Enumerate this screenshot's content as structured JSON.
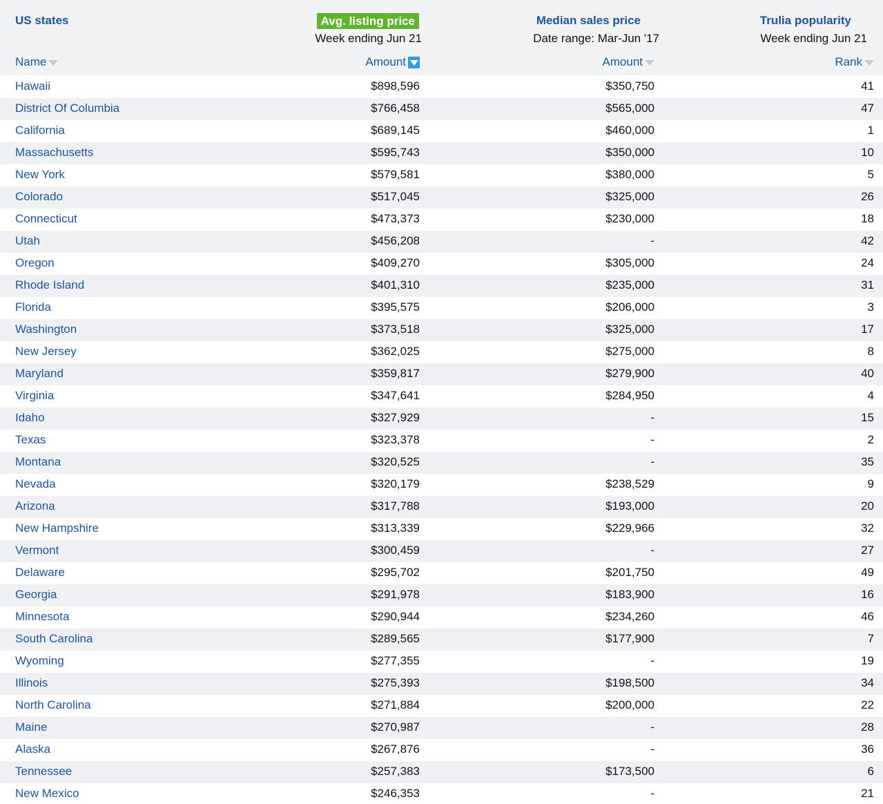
{
  "header": {
    "region_title": "US states",
    "avg_title": "Avg. listing price",
    "avg_sub": "Week ending Jun 21",
    "median_title": "Median sales price",
    "median_sub": "Date range: Mar-Jun '17",
    "popularity_title": "Trulia popularity",
    "popularity_sub": "Week ending Jun 21",
    "col_name": "Name",
    "col_avg": "Amount",
    "col_median": "Amount",
    "col_rank": "Rank"
  },
  "rows": [
    {
      "name": "Hawaii",
      "avg": "$898,596",
      "median": "$350,750",
      "rank": "41"
    },
    {
      "name": "District Of Columbia",
      "avg": "$766,458",
      "median": "$565,000",
      "rank": "47"
    },
    {
      "name": "California",
      "avg": "$689,145",
      "median": "$460,000",
      "rank": "1"
    },
    {
      "name": "Massachusetts",
      "avg": "$595,743",
      "median": "$350,000",
      "rank": "10"
    },
    {
      "name": "New York",
      "avg": "$579,581",
      "median": "$380,000",
      "rank": "5"
    },
    {
      "name": "Colorado",
      "avg": "$517,045",
      "median": "$325,000",
      "rank": "26"
    },
    {
      "name": "Connecticut",
      "avg": "$473,373",
      "median": "$230,000",
      "rank": "18"
    },
    {
      "name": "Utah",
      "avg": "$456,208",
      "median": "-",
      "rank": "42"
    },
    {
      "name": "Oregon",
      "avg": "$409,270",
      "median": "$305,000",
      "rank": "24"
    },
    {
      "name": "Rhode Island",
      "avg": "$401,310",
      "median": "$235,000",
      "rank": "31"
    },
    {
      "name": "Florida",
      "avg": "$395,575",
      "median": "$206,000",
      "rank": "3"
    },
    {
      "name": "Washington",
      "avg": "$373,518",
      "median": "$325,000",
      "rank": "17"
    },
    {
      "name": "New Jersey",
      "avg": "$362,025",
      "median": "$275,000",
      "rank": "8"
    },
    {
      "name": "Maryland",
      "avg": "$359,817",
      "median": "$279,900",
      "rank": "40"
    },
    {
      "name": "Virginia",
      "avg": "$347,641",
      "median": "$284,950",
      "rank": "4"
    },
    {
      "name": "Idaho",
      "avg": "$327,929",
      "median": "-",
      "rank": "15"
    },
    {
      "name": "Texas",
      "avg": "$323,378",
      "median": "-",
      "rank": "2"
    },
    {
      "name": "Montana",
      "avg": "$320,525",
      "median": "-",
      "rank": "35"
    },
    {
      "name": "Nevada",
      "avg": "$320,179",
      "median": "$238,529",
      "rank": "9"
    },
    {
      "name": "Arizona",
      "avg": "$317,788",
      "median": "$193,000",
      "rank": "20"
    },
    {
      "name": "New Hampshire",
      "avg": "$313,339",
      "median": "$229,966",
      "rank": "32"
    },
    {
      "name": "Vermont",
      "avg": "$300,459",
      "median": "-",
      "rank": "27"
    },
    {
      "name": "Delaware",
      "avg": "$295,702",
      "median": "$201,750",
      "rank": "49"
    },
    {
      "name": "Georgia",
      "avg": "$291,978",
      "median": "$183,900",
      "rank": "16"
    },
    {
      "name": "Minnesota",
      "avg": "$290,944",
      "median": "$234,260",
      "rank": "46"
    },
    {
      "name": "South Carolina",
      "avg": "$289,565",
      "median": "$177,900",
      "rank": "7"
    },
    {
      "name": "Wyoming",
      "avg": "$277,355",
      "median": "-",
      "rank": "19"
    },
    {
      "name": "Illinois",
      "avg": "$275,393",
      "median": "$198,500",
      "rank": "34"
    },
    {
      "name": "North Carolina",
      "avg": "$271,884",
      "median": "$200,000",
      "rank": "22"
    },
    {
      "name": "Maine",
      "avg": "$270,987",
      "median": "-",
      "rank": "28"
    },
    {
      "name": "Alaska",
      "avg": "$267,876",
      "median": "-",
      "rank": "36"
    },
    {
      "name": "Tennessee",
      "avg": "$257,383",
      "median": "$173,500",
      "rank": "6"
    },
    {
      "name": "New Mexico",
      "avg": "$246,353",
      "median": "-",
      "rank": "21"
    }
  ],
  "colors": {
    "link": "#1b56a3",
    "highlight": "#60b22f",
    "sort_active": "#3b97de",
    "row_alt": "#eef0f3",
    "header_bg": "#f1f2f4"
  }
}
